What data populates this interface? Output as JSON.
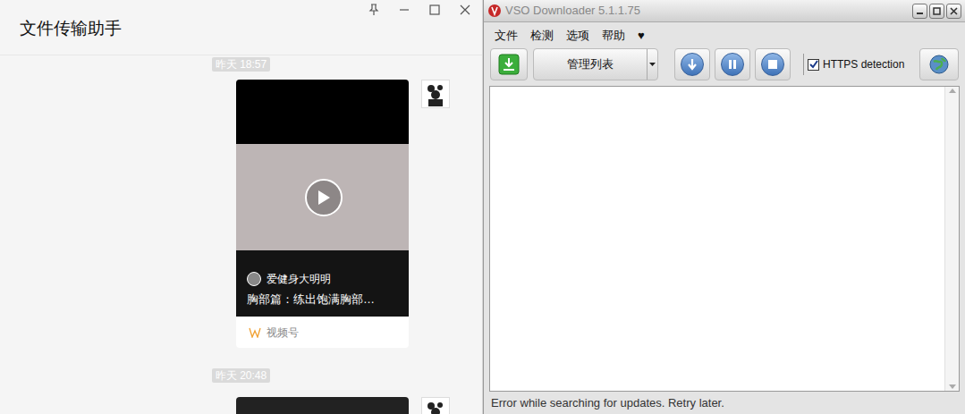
{
  "wechat": {
    "title": "文件传输助手",
    "messages": [
      {
        "time": "昨天 18:57",
        "card": {
          "author": "爱健身大明明",
          "description": "胸部篇：练出饱满胸部…",
          "source": "视频号"
        }
      },
      {
        "time": "昨天 20:48"
      }
    ]
  },
  "vso": {
    "title": "VSO Downloader 5.1.1.75",
    "menu": [
      "文件",
      "检测",
      "选项",
      "帮助",
      "♥"
    ],
    "toolbar": {
      "list_select": "管理列表",
      "https_detection": {
        "label": "HTTPS detection",
        "checked": true
      }
    },
    "status_bar": "Error while searching for updates. Retry later."
  }
}
